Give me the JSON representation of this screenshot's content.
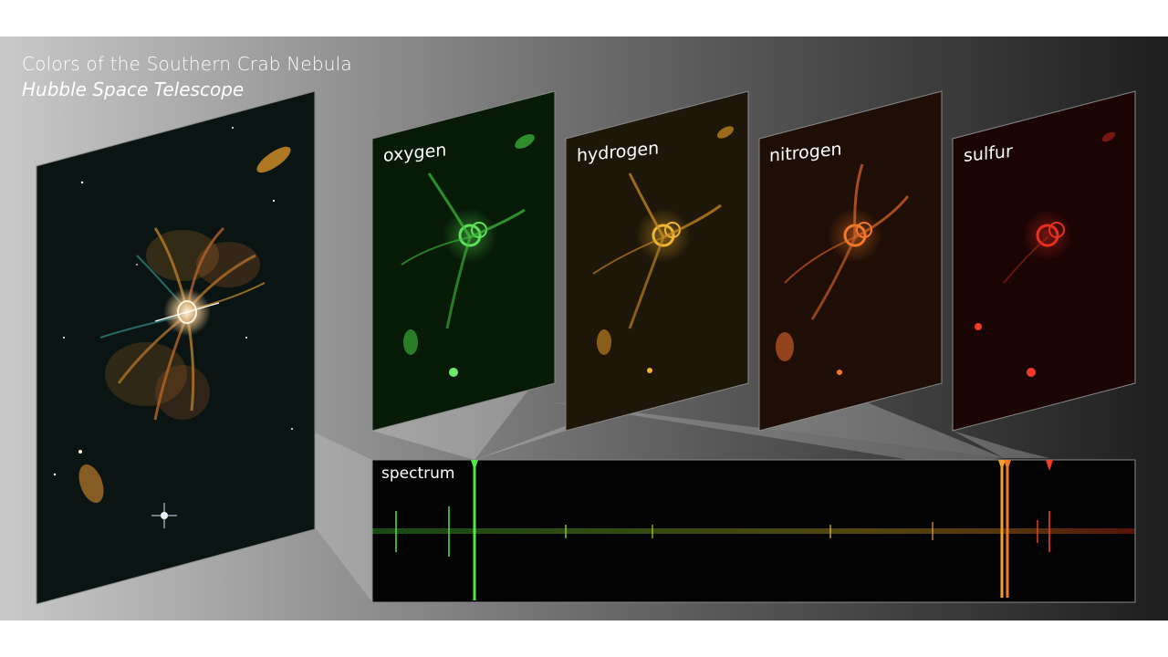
{
  "title": {
    "line1": "Colors of the Southern Crab Nebula",
    "line2": "Hubble Space Telescope"
  },
  "panels": [
    {
      "label": "oxygen",
      "color": "#37c83a"
    },
    {
      "label": "hydrogen",
      "color": "#e0a019"
    },
    {
      "label": "nitrogen",
      "color": "#ef6c1c"
    },
    {
      "label": "sulfur",
      "color": "#e02a1a"
    }
  ],
  "spectrum": {
    "label": "spectrum"
  },
  "colors": {
    "background_light": "#c9c9c9",
    "background_dark": "#1e1e1e",
    "nebula_core": "#f2e6c8"
  }
}
